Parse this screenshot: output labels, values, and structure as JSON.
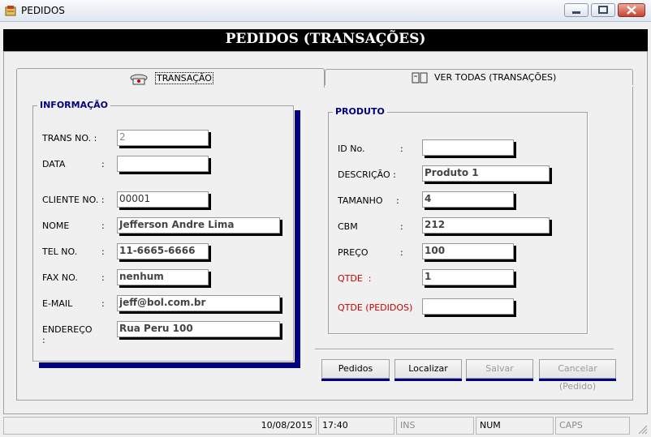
{
  "window": {
    "title": "PEDIDOS"
  },
  "header": {
    "title": "PEDIDOS (TRANSAÇÕES)"
  },
  "tabs": [
    {
      "label": "TRANSAÇÃO",
      "active": true,
      "icon": "telephone-icon"
    },
    {
      "label": "VER TODAS (TRANSAÇÕES)",
      "active": false,
      "icon": "book-icon"
    }
  ],
  "informacao": {
    "title": "INFORMAÇÃO",
    "trans_no": {
      "label": "TRANS NO. :",
      "value": "2"
    },
    "data": {
      "label": "DATA",
      "colon": ":",
      "value": ""
    },
    "cliente_no": {
      "label": "CLIENTE NO. :",
      "value": "00001"
    },
    "nome": {
      "label": "NOME",
      "colon": ":",
      "value": "Jefferson Andre Lima"
    },
    "tel_no": {
      "label": "TEL NO.",
      "colon": ":",
      "value": "11-6665-6666"
    },
    "fax_no": {
      "label": "FAX NO.",
      "colon": ":",
      "value": "nenhum"
    },
    "email": {
      "label": "E-MAIL",
      "colon": ":",
      "value": "jeff@bol.com.br"
    },
    "endereco": {
      "label": "ENDEREÇO",
      "colon": ":",
      "value": "Rua Peru 100"
    }
  },
  "produto": {
    "title": "PRODUTO",
    "id_no": {
      "label": "ID No.",
      "colon": ":",
      "value": ""
    },
    "descricao": {
      "label": "DESCRIÇÃO :",
      "value": "Produto 1"
    },
    "tamanho": {
      "label": "TAMANHO",
      "colon": ":",
      "value": "4"
    },
    "cbm": {
      "label": "CBM",
      "colon": ":",
      "value": "212"
    },
    "preco": {
      "label": "PREÇO",
      "colon": ":",
      "value": "100"
    },
    "qtde": {
      "label": "QTDE  :",
      "value": "1"
    },
    "qtde_pedidos": {
      "label": "QTDE (PEDIDOS)",
      "value": ""
    }
  },
  "buttons": {
    "pedidos": {
      "label": "Pedidos",
      "enabled": true
    },
    "localizar": {
      "label": "Localizar",
      "enabled": true
    },
    "salvar": {
      "label": "Salvar",
      "enabled": false
    },
    "cancelar": {
      "label": "Cancelar (Pedido)",
      "enabled": false
    }
  },
  "statusbar": {
    "date": "10/08/2015",
    "time": "17:40",
    "ins": "INS",
    "num": "NUM",
    "caps": "CAPS"
  },
  "colors": {
    "header_bg": "#000000",
    "accent_navy": "#000080",
    "label_red": "#cc0000"
  }
}
